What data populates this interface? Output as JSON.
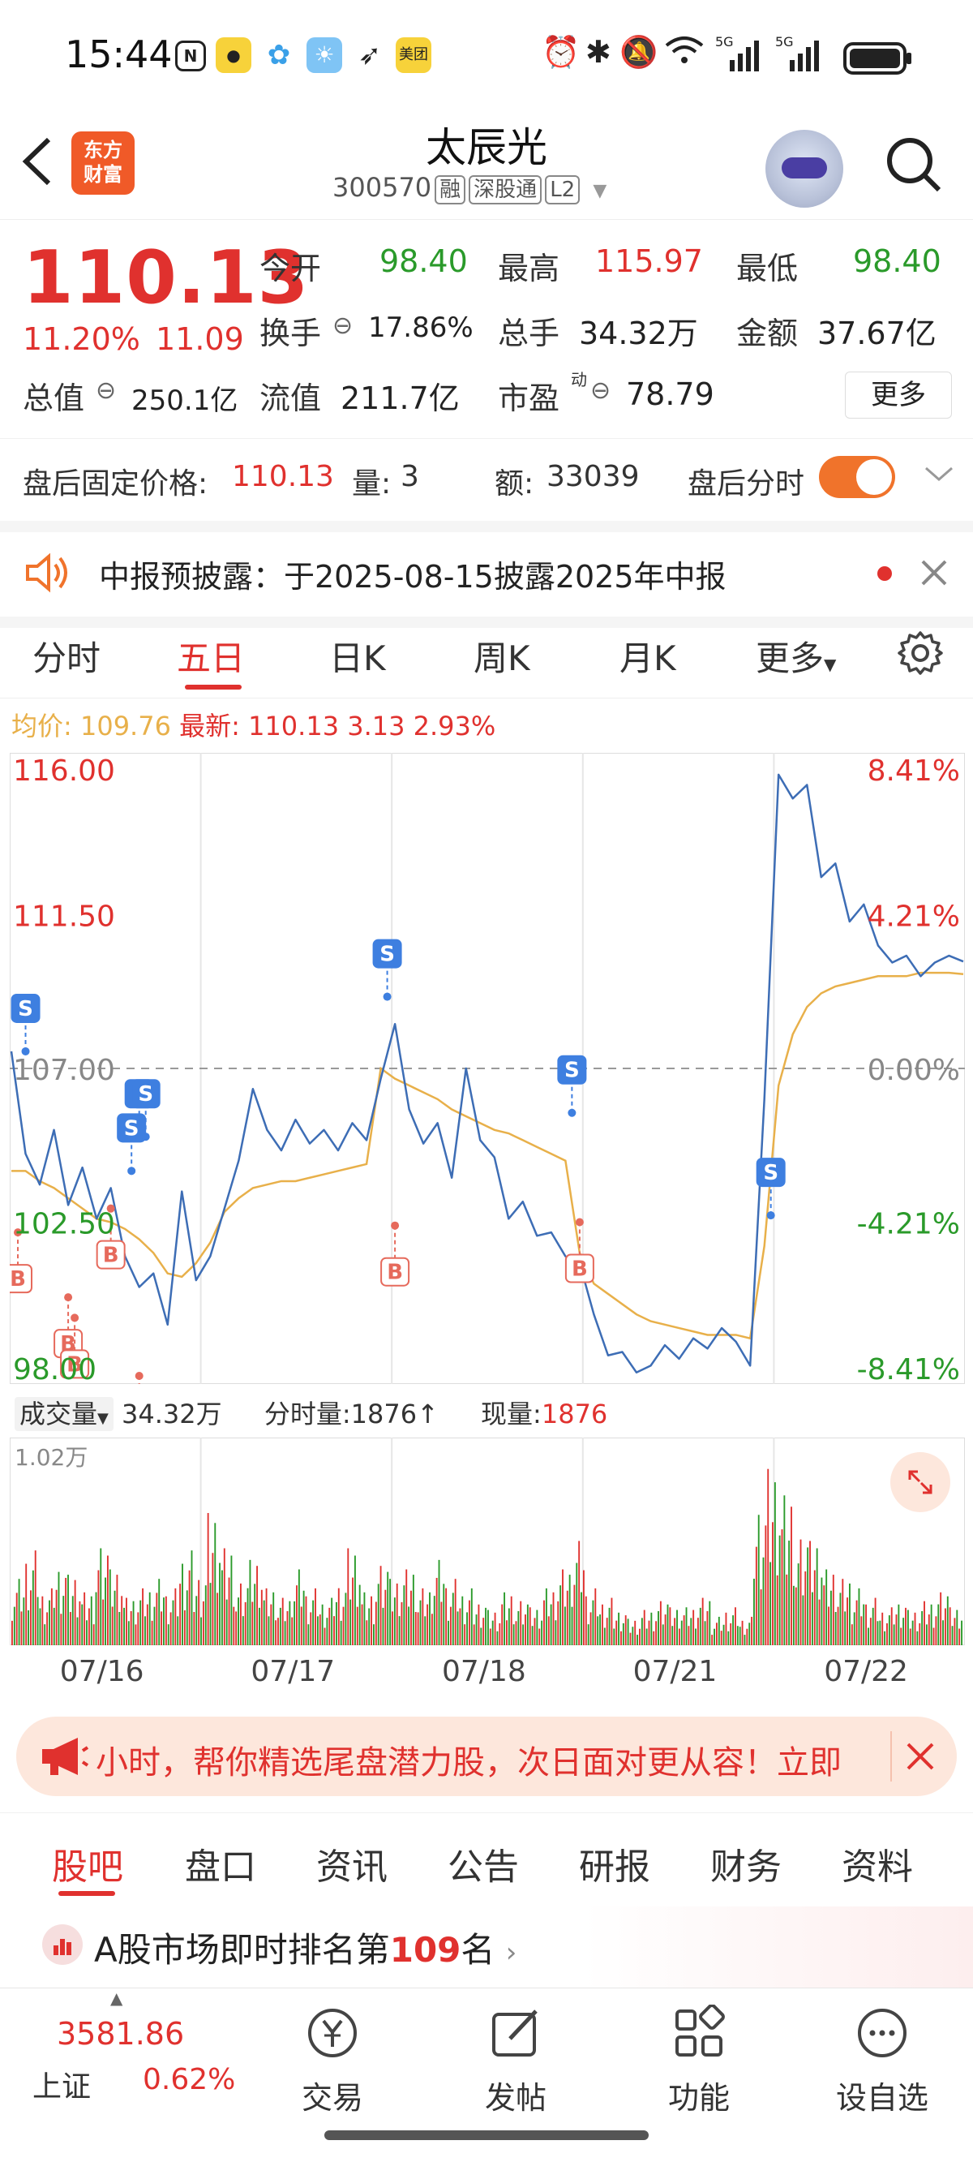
{
  "status_bar": {
    "time": "15:44",
    "app_icons": [
      "nfc-icon",
      "app-icon-1",
      "pinwheel-icon",
      "weather-icon",
      "feather-icon",
      "meituan-icon"
    ],
    "meituan_label": "美团",
    "right_icons": [
      "alarm-icon",
      "bluetooth-icon",
      "mute-icon",
      "wifi-icon",
      "signal-5g-icon",
      "signal-5g-icon",
      "battery-icon"
    ],
    "net1": "5G",
    "net2": "5G"
  },
  "header": {
    "logo_line1": "东方",
    "logo_line2": "财富",
    "stock_name": "太辰光",
    "stock_code": "300570",
    "tags": [
      "融",
      "深股通",
      "L2"
    ]
  },
  "quote": {
    "price": "110.13",
    "change_pct": "11.20%",
    "change_amt": "11.09",
    "open_label": "今开",
    "open": "98.40",
    "high_label": "最高",
    "high": "115.97",
    "low_label": "最低",
    "low": "98.40",
    "turnover_label": "换手",
    "turnover": "17.86%",
    "volume_label": "总手",
    "volume": "34.32万",
    "amount_label": "金额",
    "amount": "37.67亿",
    "mktcap_label": "总值",
    "mktcap": "250.1亿",
    "float_label": "流值",
    "float": "211.7亿",
    "pe_label": "市盈",
    "pe_sup": "动",
    "pe": "78.79",
    "more_label": "更多"
  },
  "after_hours": {
    "price_label": "盘后固定价格:",
    "price": "110.13",
    "vol_label": "量:",
    "vol": "3",
    "amt_label": "额:",
    "amt": "33039",
    "toggle_label": "盘后分时"
  },
  "notice": {
    "text": "中报预披露：于2025-08-15披露2025年中报"
  },
  "chart_tabs": [
    "分时",
    "五日",
    "日K",
    "周K",
    "月K",
    "更多"
  ],
  "avg_line": {
    "avg_label": "均价:",
    "avg": "109.76",
    "latest_label": "最新:",
    "latest": "110.13",
    "chg": "3.13",
    "chg_pct": "2.93%"
  },
  "chart_data": {
    "type": "line",
    "days": [
      "07/16",
      "07/17",
      "07/18",
      "07/21",
      "07/22"
    ],
    "y_left_ticks": [
      "116.00",
      "111.50",
      "107.00",
      "102.50",
      "98.00"
    ],
    "y_right_ticks": [
      "8.41%",
      "4.21%",
      "0.00%",
      "-4.21%",
      "-8.41%"
    ],
    "ylim": [
      98.0,
      116.0
    ],
    "prev_close": 107.0,
    "price_series": [
      107.5,
      104.5,
      103.6,
      105.2,
      103.0,
      104.1,
      102.6,
      103.5,
      101.5,
      100.6,
      101.0,
      99.5,
      103.4,
      100.8,
      101.5,
      102.9,
      104.3,
      106.4,
      105.2,
      104.6,
      105.5,
      104.8,
      105.2,
      104.6,
      105.4,
      104.9,
      106.7,
      108.3,
      105.8,
      104.8,
      105.4,
      103.8,
      107.0,
      104.9,
      104.4,
      102.6,
      103.1,
      102.1,
      102.2,
      101.5,
      101.3,
      99.8,
      98.6,
      98.7,
      98.1,
      98.3,
      98.9,
      98.5,
      99.1,
      98.8,
      99.4,
      99.0,
      98.3,
      106.1,
      115.6,
      114.9,
      115.3,
      112.6,
      113.0,
      111.3,
      111.8,
      110.6,
      110.1,
      110.3,
      109.7,
      110.1,
      110.3,
      110.13
    ],
    "avg_series": [
      104.0,
      104.0,
      103.7,
      103.5,
      103.2,
      102.9,
      102.6,
      102.5,
      102.3,
      102.0,
      101.6,
      101.0,
      100.9,
      101.3,
      101.9,
      102.8,
      103.2,
      103.5,
      103.6,
      103.7,
      103.7,
      103.8,
      103.9,
      104.0,
      104.1,
      104.2,
      107.0,
      106.7,
      106.5,
      106.3,
      106.1,
      105.8,
      105.6,
      105.4,
      105.2,
      105.1,
      104.9,
      104.7,
      104.5,
      104.3,
      101.6,
      100.7,
      100.4,
      100.1,
      99.8,
      99.6,
      99.5,
      99.4,
      99.3,
      99.2,
      99.2,
      99.2,
      99.1,
      101.8,
      106.5,
      108.0,
      108.8,
      109.2,
      109.4,
      109.5,
      109.6,
      109.7,
      109.7,
      109.7,
      109.8,
      109.8,
      109.8,
      109.76
    ],
    "markers": [
      {
        "label": "S",
        "type": "sell",
        "x_index": 1,
        "price": 107.5
      },
      {
        "label": "B",
        "type": "buy",
        "x_index": 0,
        "price": 102.2
      },
      {
        "label": "B",
        "type": "buy",
        "x_index": 4,
        "price": 100.3
      },
      {
        "label": "B",
        "type": "buy",
        "x_index": 4,
        "price": 99.7
      },
      {
        "label": "B",
        "type": "buy",
        "x_index": 7,
        "price": 102.9
      },
      {
        "label": "S",
        "type": "sell",
        "x_index": 8,
        "price": 104.0
      },
      {
        "label": "S",
        "type": "sell",
        "x_index": 9,
        "price": 105.0
      },
      {
        "label": "S",
        "type": "sell",
        "x_index": 9,
        "price": 105.0
      },
      {
        "label": "B",
        "type": "buy",
        "x_index": 9,
        "price": 98.0
      },
      {
        "label": "S",
        "type": "sell",
        "x_index": 26,
        "price": 109.1
      },
      {
        "label": "B",
        "type": "buy",
        "x_index": 27,
        "price": 102.4
      },
      {
        "label": "S",
        "type": "sell",
        "x_index": 39,
        "price": 105.7
      },
      {
        "label": "B",
        "type": "buy",
        "x_index": 40,
        "price": 102.5
      },
      {
        "label": "S",
        "type": "sell",
        "x_index": 53,
        "price": 102.7
      }
    ]
  },
  "volume": {
    "header_label": "成交量",
    "total": "34.32万",
    "minute_label": "分时量:",
    "minute_val": "1876",
    "minute_arrow": "↑",
    "now_label": "现量:",
    "now_val": "1876",
    "max_label": "1.02万",
    "bars": [
      0.35,
      0.5,
      0.3,
      0.45,
      0.4,
      0.3,
      0.55,
      0.4,
      0.25,
      0.3,
      0.35,
      0.3,
      0.5,
      0.4,
      0.75,
      0.55,
      0.35,
      0.45,
      0.3,
      0.25,
      0.4,
      0.3,
      0.25,
      0.35,
      0.55,
      0.3,
      0.45,
      0.35,
      0.4,
      0.3,
      0.45,
      0.35,
      0.3,
      0.25,
      0.2,
      0.3,
      0.25,
      0.2,
      0.3,
      0.4,
      0.55,
      0.3,
      0.25,
      0.2,
      0.15,
      0.2,
      0.25,
      0.2,
      0.2,
      0.25,
      0.15,
      0.2,
      0.15,
      0.8,
      1.0,
      0.85,
      0.6,
      0.55,
      0.4,
      0.35,
      0.3,
      0.25,
      0.2,
      0.25,
      0.2,
      0.25,
      0.3,
      0.2
    ]
  },
  "banner": {
    "text": "小时，帮你精选尾盘潜力股，次日面对更从容！立即"
  },
  "bottom_tabs": [
    "股吧",
    "盘口",
    "资讯",
    "公告",
    "研报",
    "财务",
    "资料"
  ],
  "rank": {
    "prefix": "A股市场即时排名第",
    "rank": "109",
    "suffix": "名"
  },
  "nav": {
    "index_value": "3581.86",
    "index_name": "上证",
    "index_pct": "0.62%",
    "items": [
      "交易",
      "发帖",
      "功能",
      "设自选"
    ]
  },
  "colors": {
    "up": "#e0312e",
    "down": "#2a9a2a",
    "accent": "#f0732b",
    "line": "#3d6db5",
    "avg": "#e8b04a"
  }
}
